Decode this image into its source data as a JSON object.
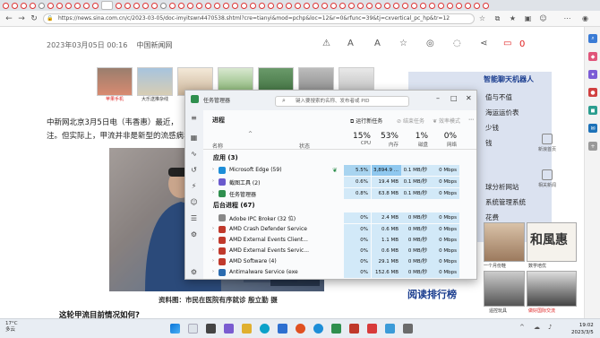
{
  "browser": {
    "url": "https://news.sina.com.cn/c/2023-03-05/doc-imyitswn4470538.shtml?cre=tianyi&mod=pchp&loc=12&r=0&rfunc=39&tj=cxvertical_pc_hp&tr=12"
  },
  "article": {
    "date": "2023年03月05日 00:16",
    "source": "中国新闻网",
    "comment_count": "0",
    "thumb_captions": [
      "苹果手机",
      "大乐送推杂线"
    ],
    "para1": "中新网北京3月5日电（韦香惠）最近，",
    "para2": "注。但实际上，甲流并非是新型的流感病毒",
    "photo_caption": "资料图：市民在医院有序就诊 殷立勤 摄",
    "subhead": "这轮甲流目前情况如何?"
  },
  "right": {
    "lines": [
      "智能聊天机器人",
      "值与不值",
      "海运运价表",
      "少钱",
      "钱",
      "",
      "",
      "",
      "",
      "球分析网站",
      "系统管理系统",
      "花费"
    ],
    "ranking": "阅读排行榜",
    "photo_labels": [
      "一个月份鞋",
      "数学培优",
      "遥控玩具",
      "做好国际交流"
    ],
    "tools": [
      "新浪首页",
      "相关新闻"
    ]
  },
  "task_manager": {
    "title": "任务管理器",
    "search_placeholder": "键入要搜索的名称、发布者或 PID",
    "tab_title": "进程",
    "toolbar": [
      "运行新任务",
      "结束任务",
      "效率模式"
    ],
    "headers": {
      "name": "名称",
      "status": "状态"
    },
    "columns": [
      {
        "pct": "15%",
        "label": "CPU"
      },
      {
        "pct": "53%",
        "label": "内存"
      },
      {
        "pct": "1%",
        "label": "磁盘"
      },
      {
        "pct": "0%",
        "label": "网络"
      }
    ],
    "sections": {
      "apps": "应用 (3)",
      "background": "后台进程 (67)"
    },
    "apps": [
      {
        "name": "Microsoft Edge (59)",
        "cpu": "5.5%",
        "mem": "3,894.9 ...",
        "disk": "0.1 MB/秒",
        "net": "0 Mbps",
        "color": "#1d8ed8"
      },
      {
        "name": "截图工具 (2)",
        "cpu": "0.6%",
        "mem": "19.4 MB",
        "disk": "0.1 MB/秒",
        "net": "0 Mbps",
        "color": "#6a5acd"
      },
      {
        "name": "任务管理器",
        "cpu": "0.8%",
        "mem": "63.8 MB",
        "disk": "0.1 MB/秒",
        "net": "0 Mbps",
        "color": "#2f8f4e"
      }
    ],
    "background": [
      {
        "name": "Adobe IPC Broker (32 位)",
        "cpu": "0%",
        "mem": "2.4 MB",
        "disk": "0 MB/秒",
        "net": "0 Mbps",
        "color": "#888888"
      },
      {
        "name": "AMD Crash Defender Service",
        "cpu": "0%",
        "mem": "0.6 MB",
        "disk": "0 MB/秒",
        "net": "0 Mbps",
        "color": "#c0392b"
      },
      {
        "name": "AMD External Events Client...",
        "cpu": "0%",
        "mem": "1.1 MB",
        "disk": "0 MB/秒",
        "net": "0 Mbps",
        "color": "#c0392b"
      },
      {
        "name": "AMD External Events Servic...",
        "cpu": "0%",
        "mem": "0.6 MB",
        "disk": "0 MB/秒",
        "net": "0 Mbps",
        "color": "#c0392b"
      },
      {
        "name": "AMD Software (4)",
        "cpu": "0%",
        "mem": "29.1 MB",
        "disk": "0 MB/秒",
        "net": "0 Mbps",
        "color": "#c0392b"
      },
      {
        "name": "Antimalware Service (exe",
        "cpu": "0%",
        "mem": "152.6 MB",
        "disk": "0 MB/秒",
        "net": "0 Mbps",
        "color": "#2b6cb0"
      }
    ]
  },
  "taskbar": {
    "weather_temp": "17°C",
    "weather_desc": "多云",
    "time": "19:02",
    "date": "2023/3/5"
  }
}
